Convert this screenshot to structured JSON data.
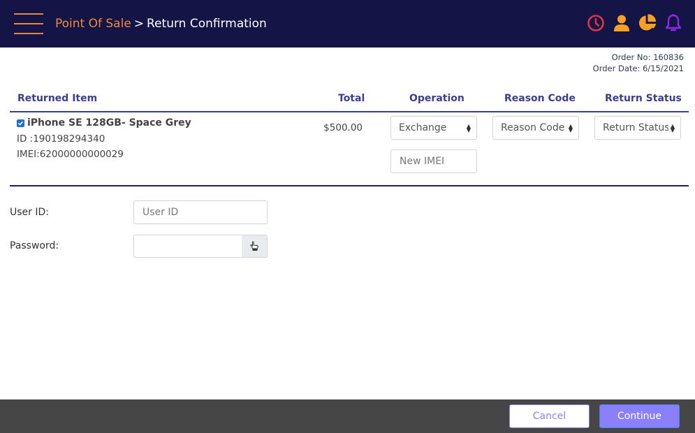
{
  "header": {
    "breadcrumb_root": "Point Of Sale",
    "breadcrumb_separator": ">",
    "breadcrumb_current": "Return Confirmation",
    "icons": [
      "clock-icon",
      "user-icon",
      "pie-chart-icon",
      "bell-icon"
    ],
    "colors": {
      "background": "#141446",
      "accent": "#f0883a",
      "clock": "#e0344a",
      "bell": "#8a2be2"
    }
  },
  "order": {
    "number_label": "Order No: 160836",
    "date_label": "Order Date: 6/15/2021"
  },
  "table": {
    "columns": [
      "Returned Item",
      "Total",
      "Operation",
      "Reason Code",
      "Return Status"
    ],
    "rows": [
      {
        "checked": true,
        "name": "iPhone SE 128GB- Space Grey",
        "id_line": "ID :190198294340",
        "imei_line": "IMEI:62000000000029",
        "total": "$500.00",
        "operation": "Exchange",
        "reason_code": "Reason Code",
        "return_status": "Return Status",
        "new_imei_placeholder": "New IMEI"
      }
    ]
  },
  "form": {
    "user_id_label": "User ID:",
    "user_id_placeholder": "User ID",
    "password_label": "Password:"
  },
  "footer": {
    "cancel_label": "Cancel",
    "continue_label": "Continue"
  }
}
